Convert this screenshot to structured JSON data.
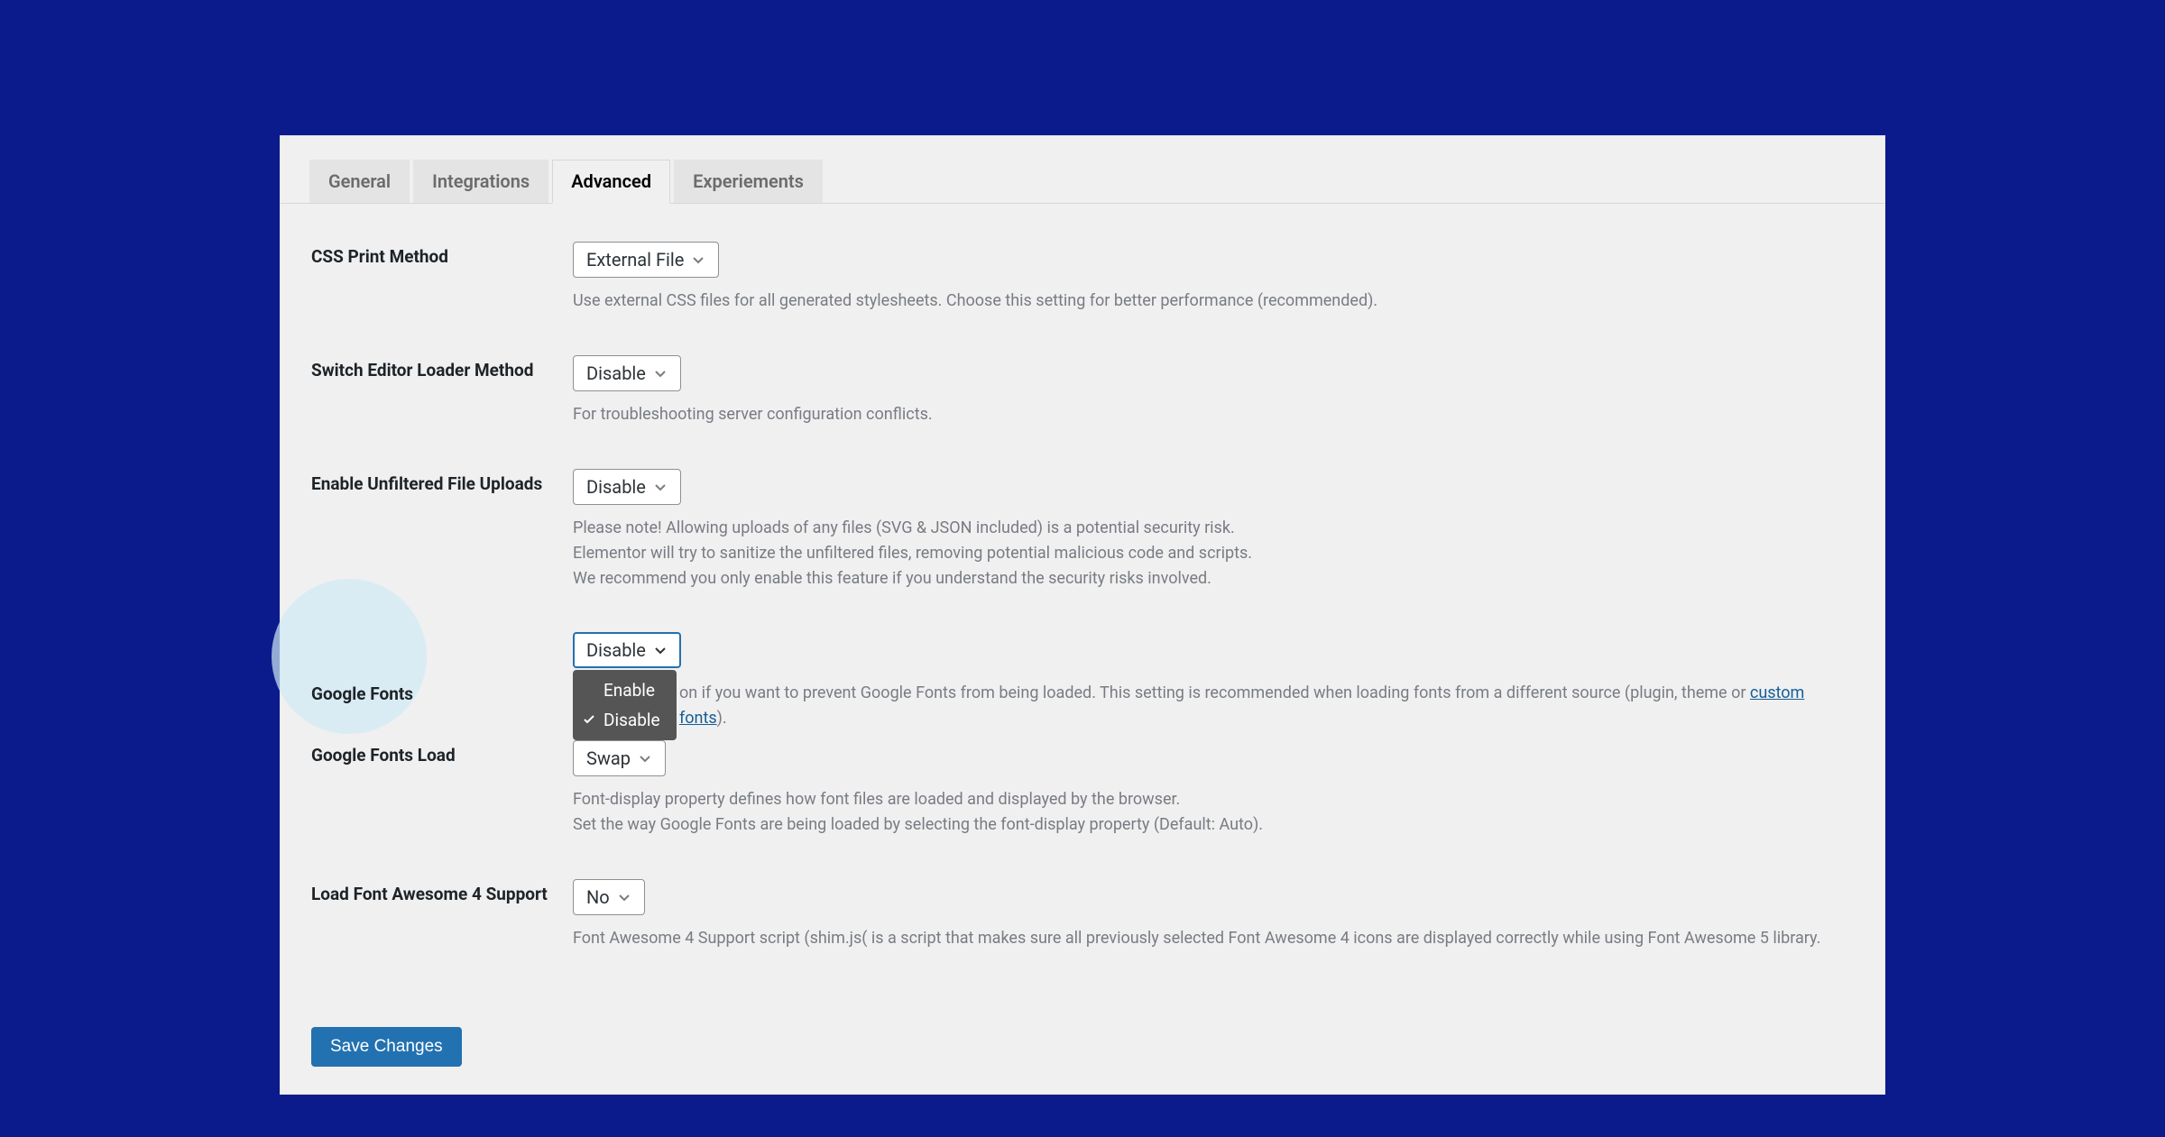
{
  "tabs": {
    "general": "General",
    "integrations": "Integrations",
    "advanced": "Advanced",
    "experiments": "Experiements"
  },
  "settings": {
    "css_print": {
      "label": "CSS Print Method",
      "value": "External File",
      "desc": "Use external CSS files for all generated stylesheets. Choose this setting for better performance (recommended)."
    },
    "switch_editor": {
      "label": "Switch Editor Loader Method",
      "value": "Disable",
      "desc": "For troubleshooting server configuration conflicts."
    },
    "unfiltered_uploads": {
      "label": "Enable Unfiltered File Uploads",
      "value": "Disable",
      "desc_l1": "Please note! Allowing uploads of any files (SVG & JSON included) is a potential security risk.",
      "desc_l2": "Elementor will try to sanitize the unfiltered files, removing potential malicious code and scripts.",
      "desc_l3": "We recommend you only enable this feature if you understand the security risks involved."
    },
    "google_fonts": {
      "label": "Google Fonts",
      "value": "Disable",
      "desc_before_link": "on if you want to prevent Google Fonts from being loaded. This setting is recommended when loading fonts from a different source (plugin, theme or ",
      "link_text": "custom fonts",
      "desc_after_link": ").",
      "options": {
        "enable": "Enable",
        "disable": "Disable"
      }
    },
    "google_fonts_load": {
      "label": "Google Fonts Load",
      "value": "Swap",
      "desc_l1": "Font-display property defines how font files are loaded and displayed by the browser.",
      "desc_l2": "Set the way Google Fonts are being loaded by selecting the font-display property (Default: Auto)."
    },
    "fa4": {
      "label": "Load Font Awesome 4 Support",
      "value": "No",
      "desc": "Font Awesome 4 Support script (shim.js( is a script that makes sure all previously selected Font Awesome 4 icons are displayed correctly while using Font Awesome 5 library."
    }
  },
  "save_button": "Save Changes"
}
